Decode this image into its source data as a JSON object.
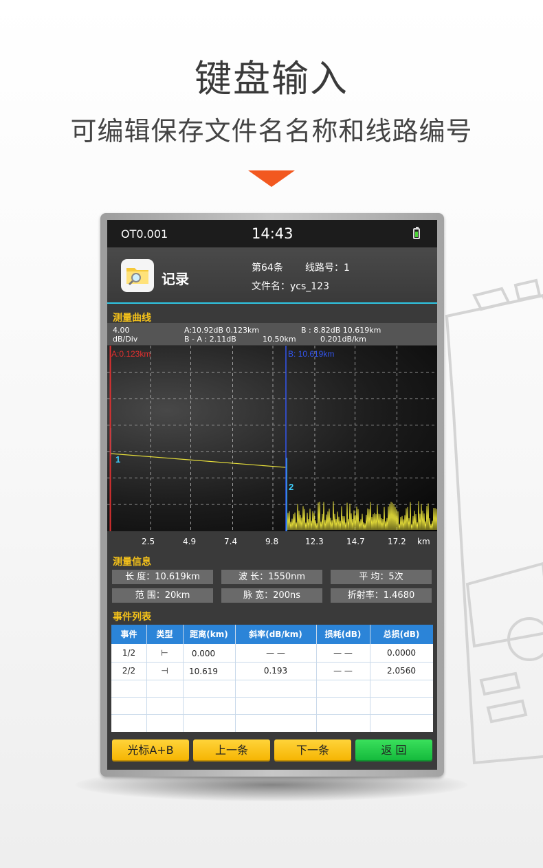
{
  "headline": "键盘输入",
  "subheadline": "可编辑保存文件名名称和线路编号",
  "status": {
    "model": "OT0.001",
    "time": "14:43"
  },
  "header": {
    "title": "记录",
    "record_no": "第64条",
    "line_no": "线路号：1",
    "file_name": "文件名：ycs_123"
  },
  "curve": {
    "section_title": "测量曲线",
    "scale": "4.00",
    "scale_unit": "dB/Div",
    "a_info": "A:10.92dB   0.123km",
    "b_info": "B : 8.82dB    10.619km",
    "ba_info": "B - A : 2.11dB",
    "ba_distance": "10.50km",
    "ba_slope": "0.201dB/km",
    "marker_a": "A:0.123km",
    "marker_b": "B: 10.619km",
    "event1": "1",
    "event2": "2",
    "x_ticks": [
      "2.5",
      "4.9",
      "7.4",
      "9.8",
      "12.3",
      "14.7",
      "17.2"
    ],
    "x_unit": "km"
  },
  "chart_data": {
    "type": "line",
    "x_unit": "km",
    "xlim": [
      0,
      19.6
    ],
    "trace": {
      "start_km": 0.123,
      "start_db": 10.92,
      "end_km": 10.619,
      "end_db": 8.82
    },
    "cursors": [
      {
        "name": "A",
        "x": 0.123
      },
      {
        "name": "B",
        "x": 10.619
      }
    ],
    "events": [
      {
        "label": "1",
        "x": 0.123
      },
      {
        "label": "2",
        "x": 10.619
      }
    ]
  },
  "measure": {
    "section_title": "测量信息",
    "length": "长  度：10.619km",
    "wavelength": "波  长：1550nm",
    "average": "平  均：5次",
    "range": "范  围：20km",
    "pulse": "脉  宽：200ns",
    "ior": "折射率：1.4680"
  },
  "events": {
    "section_title": "事件列表",
    "columns": [
      "事件",
      "类型",
      "距离(km)",
      "斜率(dB/km)",
      "损耗(dB)",
      "总损(dB)"
    ],
    "rows": [
      [
        "1/2",
        "⊢",
        "0.000",
        "— —",
        "— —",
        "0.0000"
      ],
      [
        "2/2",
        "⊣",
        "10.619",
        "0.193",
        "— —",
        "2.0560"
      ]
    ]
  },
  "buttons": {
    "cursor": "光标A+B",
    "prev": "上一条",
    "next": "下一条",
    "back": "返  回"
  },
  "colors": {
    "accent": "#f2581f",
    "cyan": "#2fc8e6",
    "trace": "#e8e03a",
    "cursor_a": "#e03030",
    "cursor_b": "#3355ee",
    "button_yellow": "#f5b400",
    "button_green": "#13b83a"
  }
}
